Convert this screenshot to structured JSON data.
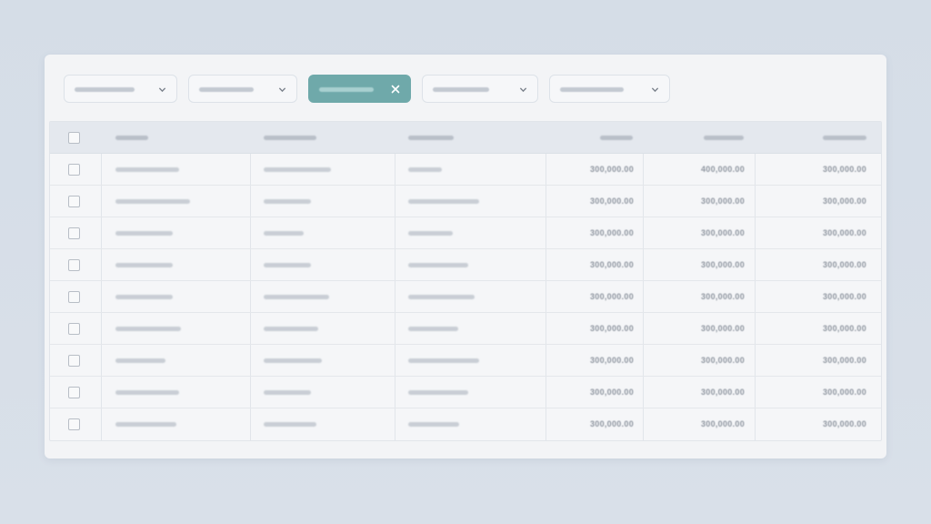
{
  "filters": [
    {
      "name": "filter-1",
      "active": false
    },
    {
      "name": "filter-2",
      "active": false
    },
    {
      "name": "filter-3",
      "active": true
    },
    {
      "name": "filter-4",
      "active": false
    },
    {
      "name": "filter-5",
      "active": false
    }
  ],
  "colors": {
    "accent": "#6fa9aa",
    "panel": "#f3f4f6",
    "header": "#e4e8ee"
  },
  "icons": [
    "chevron-down-icon",
    "close-icon",
    "checkbox-icon"
  ],
  "table": {
    "rows": [
      {
        "c1": "300,000.00",
        "c2": "400,000.00",
        "c3": "300,000.00"
      },
      {
        "c1": "300,000.00",
        "c2": "300,000.00",
        "c3": "300,000.00"
      },
      {
        "c1": "300,000.00",
        "c2": "300,000.00",
        "c3": "300,000.00"
      },
      {
        "c1": "300,000.00",
        "c2": "300,000.00",
        "c3": "300,000.00"
      },
      {
        "c1": "300,000.00",
        "c2": "300,000.00",
        "c3": "300,000.00"
      },
      {
        "c1": "300,000.00",
        "c2": "300,000.00",
        "c3": "300,000.00"
      },
      {
        "c1": "300,000.00",
        "c2": "300,000.00",
        "c3": "300,000.00"
      },
      {
        "c1": "300,000.00",
        "c2": "300,000.00",
        "c3": "300,000.00"
      },
      {
        "c1": "300,000.00",
        "c2": "300,000.00",
        "c3": "300,000.00"
      }
    ]
  }
}
